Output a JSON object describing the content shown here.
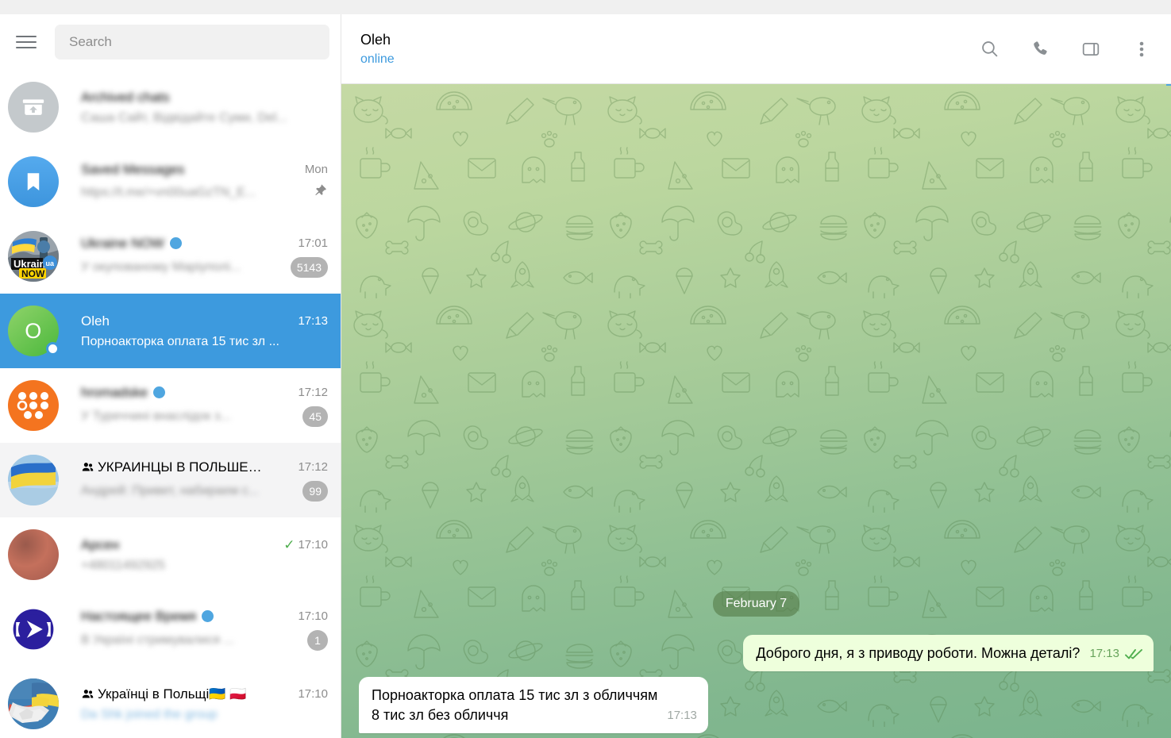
{
  "sidebar": {
    "hamburger_name": "menu-icon",
    "search": {
      "placeholder": "Search",
      "value": ""
    },
    "chats": [
      {
        "name": "Archived chats",
        "preview": "Саша Сайт, Відвідайте Суми, Del...",
        "time": "",
        "badge": "",
        "blurred": true,
        "avatar": "archive",
        "pinned": false
      },
      {
        "name": "Saved Messages",
        "preview": "https://t.me/+vn00uaGzTN_E...",
        "time": "Mon",
        "badge": "",
        "blurred": true,
        "avatar": "saved",
        "pinned": true
      },
      {
        "name": "Ukraine NOW",
        "preview": "У окупованому Маріуполі...",
        "time": "17:01",
        "badge": "5143",
        "blurred": true,
        "avatar": "ukraine-now",
        "verified": true,
        "channel": true
      },
      {
        "name": "Oleh",
        "preview": "Порноакторка оплата 15 тис зл  ...",
        "time": "17:13",
        "badge": "",
        "blurred": false,
        "avatar": "oleh",
        "selected": true,
        "online": true
      },
      {
        "name": "hromadske",
        "preview": "У Туреччині внаслідок з...",
        "time": "17:12",
        "badge": "45",
        "blurred": true,
        "avatar": "hromadske",
        "verified": true,
        "channel": true
      },
      {
        "name": "УКРАИНЦЫ В ПОЛЬШЕ…",
        "preview": "Андрей: Привет, набираем с...",
        "time": "17:12",
        "badge": "99",
        "blurred": true,
        "avatar": "ukr-in-poland-flag",
        "group": true,
        "hovered": true
      },
      {
        "name": "Арсен",
        "preview": "+48011492925",
        "time": "17:10",
        "badge": "",
        "blurred": true,
        "avatar": "arsen",
        "sent_check": true
      },
      {
        "name": "Настоящее Время",
        "preview": "В Україні стримувалися ...",
        "time": "17:10",
        "badge": "1",
        "blurred": true,
        "avatar": "nastoyashchee",
        "verified": true,
        "channel": true
      },
      {
        "name": "Українці в Польщі🇺🇦 🇵🇱",
        "preview": "Da Shk joined the group",
        "time": "17:10",
        "badge": "",
        "blurred": true,
        "avatar": "handshake",
        "group": true
      }
    ]
  },
  "chat": {
    "title": "Oleh",
    "status": "online",
    "actions": [
      {
        "name": "search-icon",
        "label": "Search"
      },
      {
        "name": "phone-icon",
        "label": "Call"
      },
      {
        "name": "panel-icon",
        "label": "Toggle info panel"
      },
      {
        "name": "more-vert-icon",
        "label": "More"
      }
    ],
    "date_separator": "February 7",
    "messages": [
      {
        "dir": "out",
        "text": "Доброго дня, я з приводу роботи. Можна деталі?",
        "time": "17:13",
        "status": "read"
      },
      {
        "dir": "in",
        "text": "Порноакторка оплата 15 тис зл  з обличчям\n8 тис зл без обличчя",
        "time": "17:13",
        "status": ""
      }
    ]
  },
  "colors": {
    "accent": "#3d9ade",
    "selected_row": "#3d9ade",
    "link": "#3d9ade",
    "badge": "#b3b3b3",
    "out_bubble": "#eeffdc",
    "in_bubble": "#ffffff",
    "tick_green": "#4fae4e",
    "bg_top": "#c5d9a4",
    "bg_bottom": "#7ab48d"
  }
}
